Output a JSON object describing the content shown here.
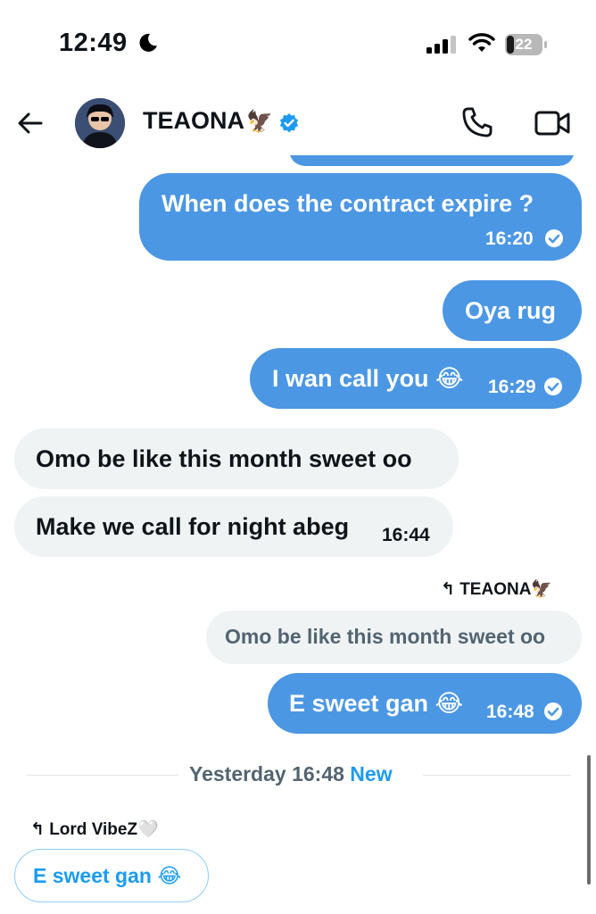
{
  "status_bar": {
    "time": "12:49",
    "battery": "22",
    "battery_level": 0.22,
    "icons": [
      "moon-icon",
      "signal-icon",
      "wifi-icon",
      "battery-icon"
    ]
  },
  "header": {
    "contact_name": "TEAONA",
    "name_emoji": "🦅",
    "verified": true,
    "icons": [
      "back-arrow-icon",
      "avatar",
      "verified-badge-icon",
      "phone-icon",
      "video-icon"
    ]
  },
  "messages": [
    {
      "id": "m1",
      "text": "When does the contract expire ?",
      "time": "16:20",
      "direction": "outgoing",
      "read": true
    },
    {
      "id": "m2",
      "text": "Oya rug",
      "direction": "outgoing"
    },
    {
      "id": "m3",
      "text": "I wan call you 😂",
      "time": "16:29",
      "direction": "outgoing",
      "read": true
    },
    {
      "id": "m4",
      "text": "Omo be like this month sweet oo",
      "direction": "incoming"
    },
    {
      "id": "m5",
      "text": "Make we call for night abeg",
      "time": "16:44",
      "direction": "incoming"
    },
    {
      "id": "m6",
      "reply_to_name": "↰ TEAONA🦅",
      "quoted_text": "Omo be like this month sweet oo",
      "text": "E sweet gan 😂",
      "time": "16:48",
      "direction": "outgoing",
      "read": true
    }
  ],
  "divider": {
    "label": "Yesterday 16:48",
    "badge": "New"
  },
  "draft": {
    "reply_to_name": "↰ Lord VibeZ🤍",
    "text": "E sweet gan 😂"
  },
  "colors": {
    "outgoing_bubble": "#4b97e3",
    "incoming_bubble": "#eff3f4",
    "verified": "#1d9bf0",
    "new_badge": "#1d9bf0",
    "muted_text": "#536471"
  }
}
